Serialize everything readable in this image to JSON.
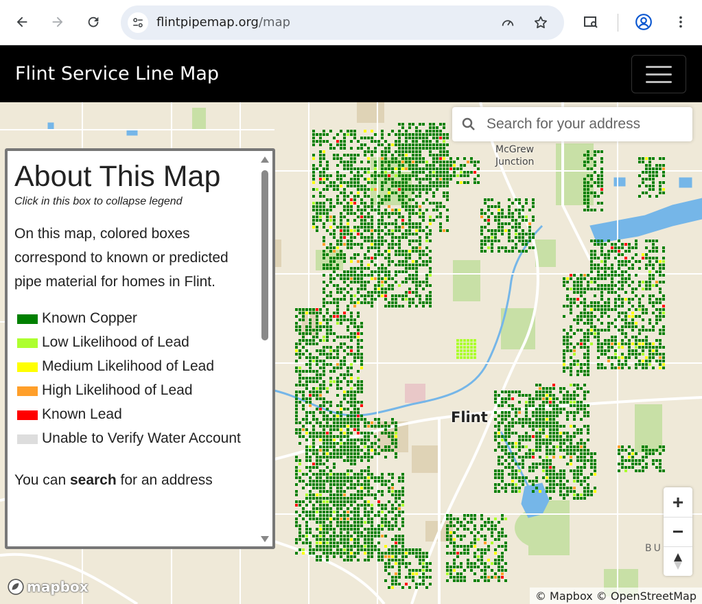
{
  "browser": {
    "url_domain": "flintpipemap.org",
    "url_path": "/map"
  },
  "app": {
    "title": "Flint Service Line Map"
  },
  "search": {
    "placeholder": "Search for your address"
  },
  "legend": {
    "title": "About This Map",
    "hint": "Click in this box to collapse legend",
    "description": "On this map, colored boxes correspond to known or predicted pipe material for homes in Flint.",
    "items": [
      {
        "label": "Known Copper",
        "color": "#008000"
      },
      {
        "label": "Low Likelihood of Lead",
        "color": "#adff2f"
      },
      {
        "label": "Medium Likelihood of Lead",
        "color": "#ffff00"
      },
      {
        "label": "High Likelihood of Lead",
        "color": "#ff9f2a"
      },
      {
        "label": "Known Lead",
        "color": "#ff0000"
      },
      {
        "label": "Unable to Verify Water Account",
        "color": "#dddddd"
      }
    ],
    "search_hint_pre": "You can ",
    "search_hint_bold": "search",
    "search_hint_post": " for an address"
  },
  "map": {
    "labels": {
      "city": "Flint",
      "mcgrew_line1": "McGrew",
      "mcgrew_line2": "Junction",
      "buick": "BU"
    },
    "logo": "mapbox",
    "attribution": "© Mapbox © OpenStreetMap",
    "zoom_in": "+",
    "zoom_out": "−"
  },
  "colors": {
    "copper": "#008000",
    "low": "#adff2f",
    "medium": "#ffff00",
    "high": "#ff9f2a",
    "lead": "#ff0000",
    "water": "#75b6e8",
    "park": "#c8e0a6",
    "land": "#efe9d8"
  }
}
